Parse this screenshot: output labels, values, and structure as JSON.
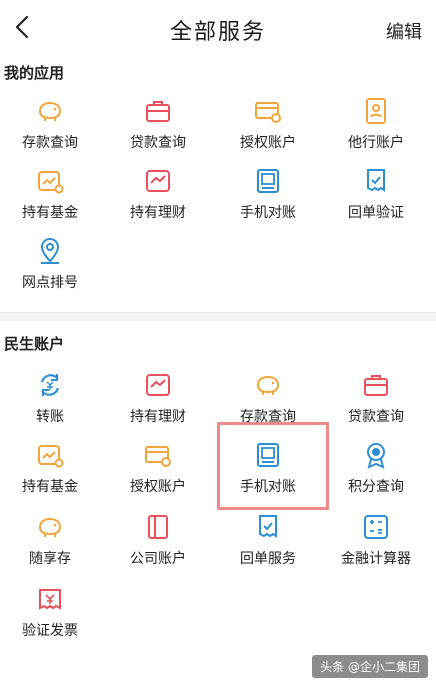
{
  "header": {
    "title": "全部服务",
    "edit_label": "编辑"
  },
  "colors": {
    "orange": "#f0a63a",
    "red": "#e8505b",
    "blue": "#2c8fd4"
  },
  "my_apps": {
    "title": "我的应用",
    "items": [
      {
        "label": "存款查询",
        "icon": "piggy-bank-icon",
        "color": "orange"
      },
      {
        "label": "贷款查询",
        "icon": "briefcase-icon",
        "color": "red"
      },
      {
        "label": "授权账户",
        "icon": "card-icon",
        "color": "orange"
      },
      {
        "label": "他行账户",
        "icon": "id-card-icon",
        "color": "orange"
      },
      {
        "label": "持有基金",
        "icon": "fund-icon",
        "color": "orange"
      },
      {
        "label": "持有理财",
        "icon": "finance-icon",
        "color": "red"
      },
      {
        "label": "手机对账",
        "icon": "phone-reconcile-icon",
        "color": "blue"
      },
      {
        "label": "回单验证",
        "icon": "receipt-verify-icon",
        "color": "blue"
      },
      {
        "label": "网点排号",
        "icon": "location-pin-icon",
        "color": "blue"
      }
    ]
  },
  "minsheng_accounts": {
    "title": "民生账户",
    "items": [
      {
        "label": "转账",
        "icon": "transfer-icon",
        "color": "blue"
      },
      {
        "label": "持有理财",
        "icon": "finance-icon",
        "color": "red"
      },
      {
        "label": "存款查询",
        "icon": "piggy-bank-icon",
        "color": "orange"
      },
      {
        "label": "贷款查询",
        "icon": "briefcase-icon",
        "color": "red"
      },
      {
        "label": "持有基金",
        "icon": "fund-icon",
        "color": "orange"
      },
      {
        "label": "授权账户",
        "icon": "card-icon",
        "color": "orange"
      },
      {
        "label": "手机对账",
        "icon": "phone-reconcile-icon",
        "color": "blue"
      },
      {
        "label": "积分查询",
        "icon": "badge-icon",
        "color": "blue"
      },
      {
        "label": "随享存",
        "icon": "piggy-bank-icon",
        "color": "orange"
      },
      {
        "label": "公司账户",
        "icon": "company-book-icon",
        "color": "red"
      },
      {
        "label": "回单服务",
        "icon": "receipt-verify-icon",
        "color": "blue"
      },
      {
        "label": "金融计算器",
        "icon": "calculator-icon",
        "color": "blue"
      },
      {
        "label": "验证发票",
        "icon": "invoice-verify-icon",
        "color": "red"
      }
    ]
  },
  "watermark": "头条 @企小二集团"
}
